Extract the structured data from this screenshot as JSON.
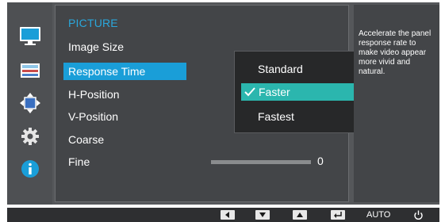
{
  "sidebar": {
    "items": [
      {
        "icon": "picture-icon",
        "active": true
      },
      {
        "icon": "onscreen-display-icon",
        "active": false
      },
      {
        "icon": "position-icon",
        "active": false
      },
      {
        "icon": "settings-gear-icon",
        "active": false
      },
      {
        "icon": "information-icon",
        "active": false
      }
    ]
  },
  "menu": {
    "title": "PICTURE",
    "items": [
      {
        "label": "Image Size"
      },
      {
        "label": "Response Time",
        "selected": true
      },
      {
        "label": "H-Position"
      },
      {
        "label": "V-Position"
      },
      {
        "label": "Coarse"
      },
      {
        "label": "Fine"
      }
    ],
    "fine_value": "0"
  },
  "submenu": {
    "options": [
      {
        "label": "Standard"
      },
      {
        "label": "Faster",
        "selected": true
      },
      {
        "label": "Fastest"
      }
    ]
  },
  "help": {
    "text": "Accelerate the panel response rate to make video appear more vivid and natural."
  },
  "buttons": {
    "left": "left-arrow-icon",
    "down": "down-arrow-icon",
    "up": "up-arrow-icon",
    "enter": "enter-icon",
    "auto_label": "AUTO",
    "power": "power-icon"
  },
  "colors": {
    "title": "#2aa7dc",
    "menu_selection": "#1a9ed8",
    "submenu_selection": "#2bb6ae",
    "background": "#55575a"
  }
}
